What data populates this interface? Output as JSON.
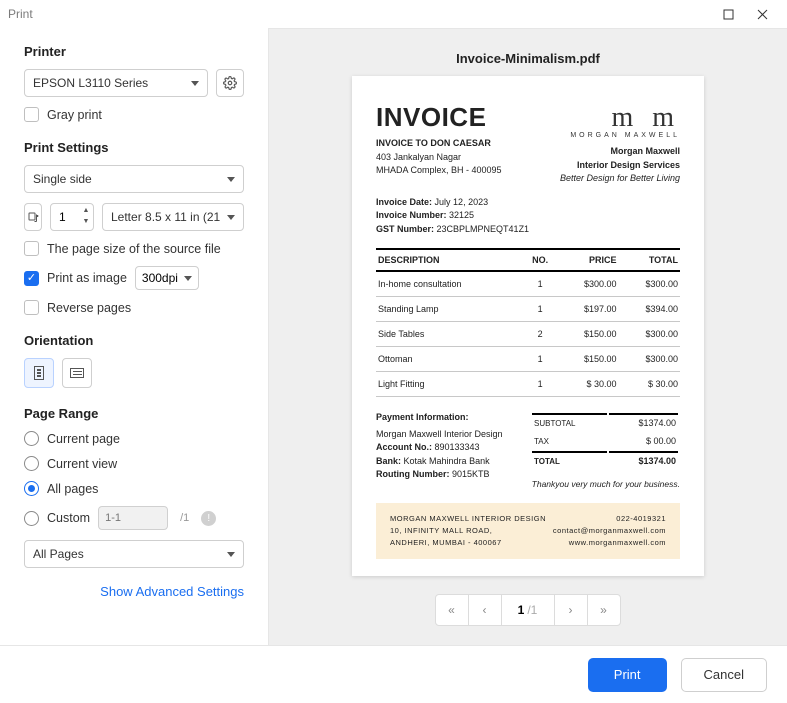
{
  "window": {
    "title": "Print"
  },
  "printer": {
    "section": "Printer",
    "selected": "EPSON L3110 Series",
    "gray_print": "Gray print"
  },
  "settings": {
    "section": "Print Settings",
    "duplex": "Single side",
    "copies": "1",
    "paper": "Letter 8.5 x 11 in (21",
    "source_size": "The page size of the source file",
    "print_as_image": "Print as image",
    "dpi": "300dpi",
    "reverse": "Reverse pages"
  },
  "orientation": {
    "section": "Orientation"
  },
  "range": {
    "section": "Page Range",
    "current_page": "Current page",
    "current_view": "Current view",
    "all_pages": "All pages",
    "custom": "Custom",
    "custom_placeholder": "1-1",
    "custom_of": "/1",
    "subset": "All Pages"
  },
  "advanced": "Show Advanced Settings",
  "preview": {
    "filename": "Invoice-Minimalism.pdf",
    "page": "1",
    "pages": "/1"
  },
  "actions": {
    "print": "Print",
    "cancel": "Cancel"
  },
  "invoice": {
    "heading": "INVOICE",
    "logo_mm": "m m",
    "logo_brand": "MORGAN MAXWELL",
    "to_label": "INVOICE TO DON CAESAR",
    "addr1": "403 Jankalyan Nagar",
    "addr2": "MHADA Complex, BH - 400095",
    "from_name": "Morgan Maxwell",
    "from_sub": "Interior Design Services",
    "from_tag": "Better Design for Better Living",
    "meta_date_l": "Invoice Date:",
    "meta_date_v": "July 12, 2023",
    "meta_num_l": "Invoice Number:",
    "meta_num_v": "32125",
    "meta_gst_l": "GST Number:",
    "meta_gst_v": "23CBPLMPNEQT41Z1",
    "th_desc": "DESCRIPTION",
    "th_no": "NO.",
    "th_price": "PRICE",
    "th_total": "TOTAL",
    "items": [
      {
        "desc": "In-home consultation",
        "no": "1",
        "price": "$300.00",
        "total": "$300.00"
      },
      {
        "desc": "Standing Lamp",
        "no": "1",
        "price": "$197.00",
        "total": "$394.00"
      },
      {
        "desc": "Side Tables",
        "no": "2",
        "price": "$150.00",
        "total": "$300.00"
      },
      {
        "desc": "Ottoman",
        "no": "1",
        "price": "$150.00",
        "total": "$300.00"
      },
      {
        "desc": "Light Fitting",
        "no": "1",
        "price": "$  30.00",
        "total": "$  30.00"
      }
    ],
    "pay_title": "Payment Information:",
    "pay_name": "Morgan Maxwell Interior Design",
    "pay_acct_l": "Account No.:",
    "pay_acct_v": "890133343",
    "pay_bank_l": "Bank:",
    "pay_bank_v": "Kotak Mahindra Bank",
    "pay_route_l": "Routing Number:",
    "pay_route_v": "9015KTB",
    "sub_l": "SUBTOTAL",
    "sub_v": "$1374.00",
    "tax_l": "TAX",
    "tax_v": "$   00.00",
    "tot_l": "TOTAL",
    "tot_v": "$1374.00",
    "thank": "Thankyou very much for your business.",
    "foot_l1": "MORGAN MAXWELL INTERIOR DESIGN",
    "foot_l2": "10, INFINITY MALL ROAD,",
    "foot_l3": "ANDHERI, MUMBAI - 400067",
    "foot_r1": "022-4019321",
    "foot_r2": "contact@morganmaxwell.com",
    "foot_r3": "www.morganmaxwell.com"
  }
}
